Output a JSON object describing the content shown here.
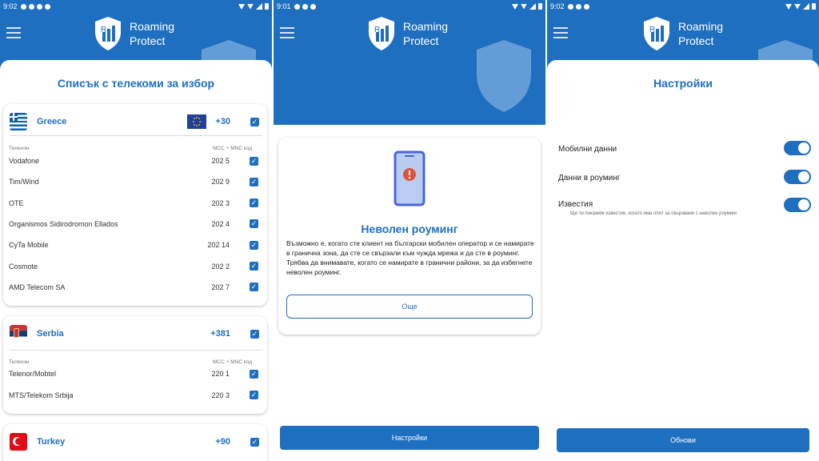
{
  "app": {
    "name_line1": "Roaming",
    "name_line2": "Protect"
  },
  "status_times": [
    "9:02",
    "9:01",
    "9:02"
  ],
  "colors": {
    "primary": "#1f6fc0",
    "background": "#ffffff",
    "card_shadow": "#bfc8d2"
  },
  "screen1": {
    "title": "Списък с телекоми за избор",
    "table_header": {
      "operator": "Телеком",
      "mcc_mnc": "MCC + MNC код"
    },
    "countries": [
      {
        "name": "Greece",
        "code": "+30",
        "eu": true,
        "operators": [
          {
            "name": "Vodafone",
            "mcc": "202 5"
          },
          {
            "name": "Tim/Wind",
            "mcc": "202 9"
          },
          {
            "name": "OTE",
            "mcc": "202 3"
          },
          {
            "name": "Organismos Sidirodromon Ellados",
            "mcc": "202 4"
          },
          {
            "name": "CyTa Mobile",
            "mcc": "202 14"
          },
          {
            "name": "Cosmote",
            "mcc": "202 2"
          },
          {
            "name": "AMD Telecom SA",
            "mcc": "202 7"
          }
        ]
      },
      {
        "name": "Serbia",
        "code": "+381",
        "eu": false,
        "operators": [
          {
            "name": "Telenor/Mobtel",
            "mcc": "220 1"
          },
          {
            "name": "MTS/Telekom Srbija",
            "mcc": "220 3"
          }
        ]
      },
      {
        "name": "Turkey",
        "code": "+90",
        "eu": false,
        "operators": []
      }
    ]
  },
  "screen2": {
    "title": "Неволен роуминг",
    "description": "Възможно е, когато сте клиент на български мобилен оператор и се намирате в гранична зона, да сте се свързали към чужда мрежа и да сте в роуминг. Трябва да внимавате, когато се намирате в гранични райони, за да избегнете неволен роуминг.",
    "more_button": "Още",
    "settings_button": "Настройки"
  },
  "screen3": {
    "title": "Настройки",
    "settings": [
      {
        "label": "Мобилни данни",
        "enabled": true
      },
      {
        "label": "Данни в роуминг",
        "enabled": true
      },
      {
        "label": "Известия",
        "enabled": true,
        "sublabel": "Ще ти покажем известие, когато има опит за свързване с неволен роуминг."
      }
    ],
    "update_button": "Обнови"
  }
}
